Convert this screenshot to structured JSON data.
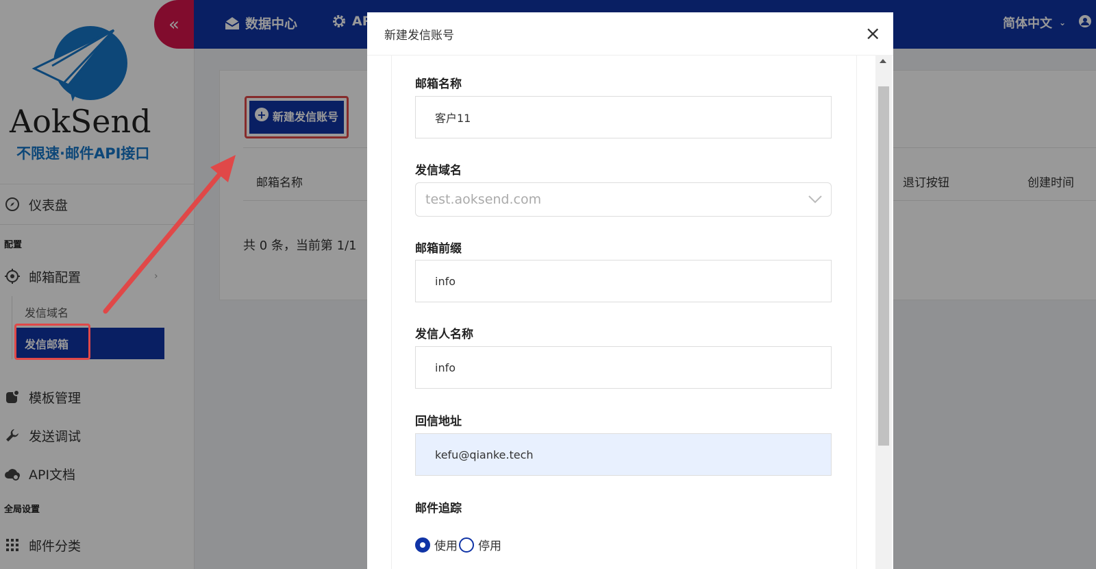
{
  "brand": {
    "name": "AokSend",
    "tagline": "不限速·邮件API接口"
  },
  "topbar": {
    "collapse_label": "«",
    "links": [
      "数据中心",
      "AP"
    ],
    "lang": "简体中文"
  },
  "sidebar": {
    "dashboard": "仪表盘",
    "section_config": "配置",
    "mail_config": "邮箱配置",
    "sub_items": [
      "发信域名",
      "发信邮箱"
    ],
    "template": "模板管理",
    "debug": "发送调试",
    "api_docs": "API文档",
    "section_global": "全局设置",
    "mail_category": "邮件分类"
  },
  "content": {
    "new_button": "新建发信账号",
    "columns": [
      "邮箱名称",
      "退订按钮",
      "创建时间"
    ],
    "pager": "共 0 条，当前第 1/1"
  },
  "modal": {
    "title": "新建发信账号",
    "close": "×",
    "fields": {
      "name_label": "邮箱名称",
      "name_value": "客户11",
      "domain_label": "发信域名",
      "domain_value": "test.aoksend.com",
      "prefix_label": "邮箱前缀",
      "prefix_value": "info",
      "sender_label": "发信人名称",
      "sender_value": "info",
      "reply_label": "回信地址",
      "reply_value": "kefu@qianke.tech",
      "tracking_label": "邮件追踪",
      "tracking_on": "使用",
      "tracking_off": "停用"
    }
  },
  "colors": {
    "primary": "#1034a6",
    "accent": "#d7154b",
    "highlight": "#e04848"
  }
}
